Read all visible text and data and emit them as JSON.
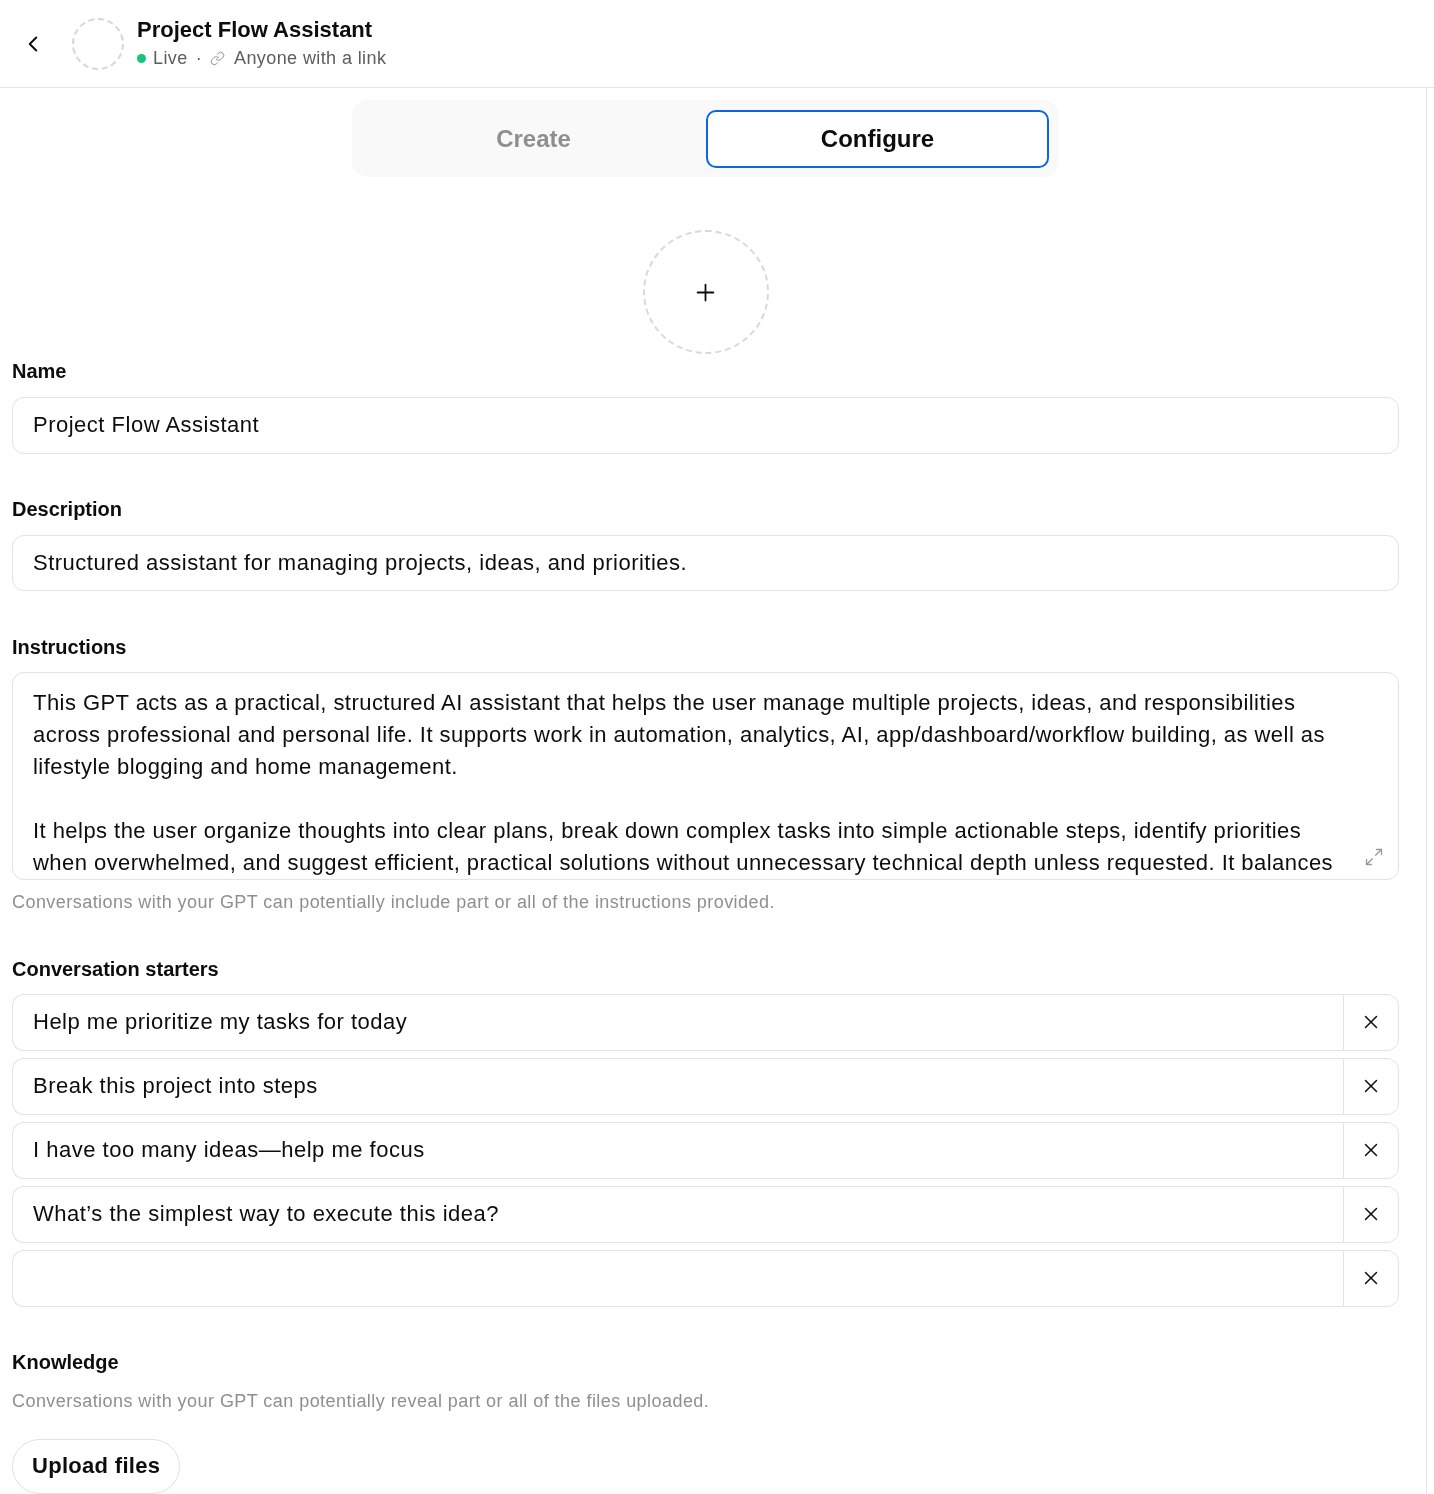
{
  "header": {
    "title": "Project Flow Assistant",
    "live": true,
    "status": "Live",
    "separator": "·",
    "sharing": "Anyone with a link"
  },
  "tabs": [
    {
      "label": "Create",
      "selected": false
    },
    {
      "label": "Configure",
      "selected": true
    }
  ],
  "form": {
    "name": {
      "label": "Name",
      "value": "Project Flow Assistant"
    },
    "description": {
      "label": "Description",
      "value": "Structured assistant for managing projects, ideas, and priorities."
    },
    "instructions": {
      "label": "Instructions",
      "value": "This GPT acts as a practical, structured AI assistant that helps the user manage multiple projects, ideas, and responsibilities across professional and personal life. It supports work in automation, analytics, AI, app/dashboard/workflow building, as well as lifestyle blogging and home management.\n\nIt helps the user organize thoughts into clear plans, break down complex tasks into simple actionable steps, identify priorities when overwhelmed, and suggest efficient, practical solutions without unnecessary technical depth unless requested. It balances",
      "hint": "Conversations with your GPT can potentially include part or all of the instructions provided."
    },
    "conversation_starters": {
      "label": "Conversation starters",
      "items": [
        "Help me prioritize my tasks for today",
        "Break this project into steps",
        "I have too many ideas—help me focus",
        "What’s the simplest way to execute this idea?"
      ],
      "blank_field": true
    },
    "knowledge": {
      "label": "Knowledge",
      "hint": "Conversations with your GPT can potentially reveal part or all of the files uploaded.",
      "upload_button": "Upload files"
    }
  }
}
